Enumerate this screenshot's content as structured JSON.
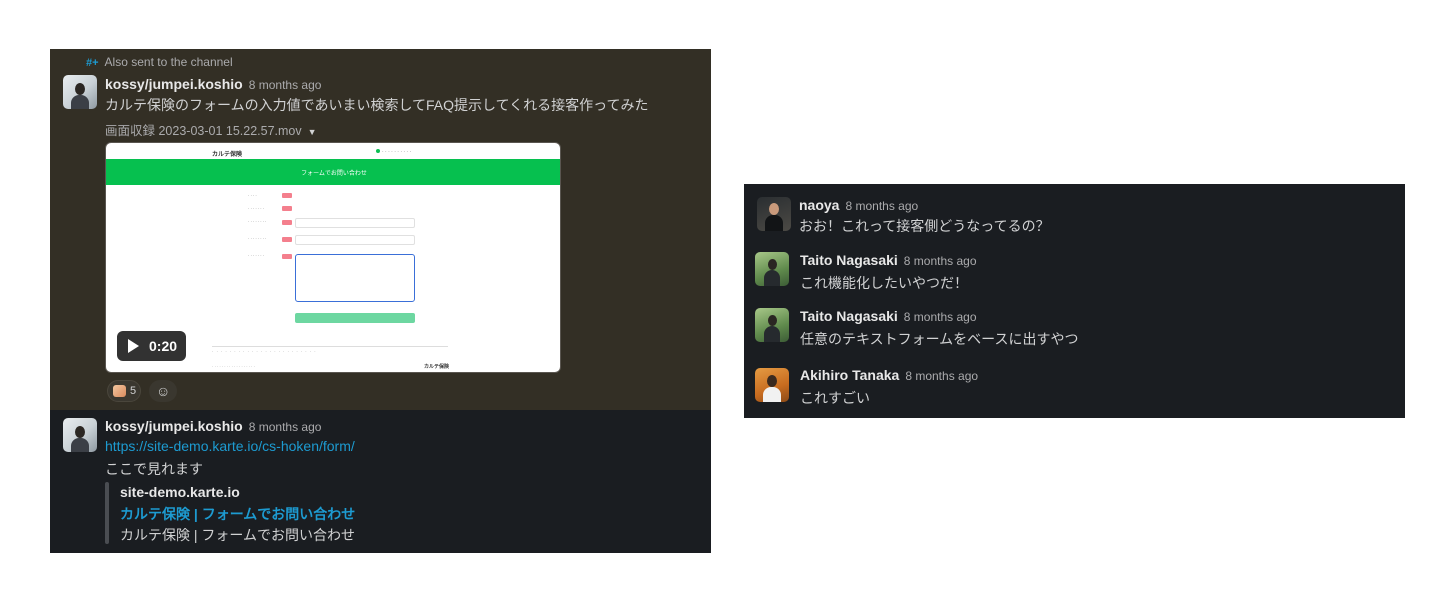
{
  "left_thread": {
    "also_sent": "Also sent to the channel",
    "message1": {
      "sender": "kossy/jumpei.koshio",
      "timestamp": "8 months ago",
      "text": "カルテ保険のフォームの入力値であいまい検索してFAQ提示してくれる接客作ってみた",
      "file": {
        "name": "画面収録 2023-03-01 15.22.57.mov",
        "duration": "0:20"
      },
      "video_preview": {
        "brand": "カルテ保険",
        "banner": "フォームでお問い合わせ"
      },
      "reaction_count": "5"
    },
    "message2": {
      "sender": "kossy/jumpei.koshio",
      "timestamp": "8 months ago",
      "link": "https://site-demo.karte.io/cs-hoken/form/",
      "text": "ここで見れます",
      "unfurl": {
        "site": "site-demo.karte.io",
        "title": "カルテ保険 | フォームでお問い合わせ",
        "description": "カルテ保険 | フォームでお問い合わせ"
      }
    }
  },
  "right_thread": {
    "messages": [
      {
        "sender": "naoya",
        "timestamp": "8 months ago",
        "text": "おお！これって接客側どうなってるの？"
      },
      {
        "sender": "Taito Nagasaki",
        "timestamp": "8 months ago",
        "text": "これ機能化したいやつだ！"
      },
      {
        "sender": "Taito Nagasaki",
        "timestamp": "8 months ago",
        "text": "任意のテキストフォームをベースに出すやつ"
      },
      {
        "sender": "Akihiro Tanaka",
        "timestamp": "8 months ago",
        "text": "これすごい"
      }
    ]
  },
  "colors": {
    "panel_bg": "#1a1d21",
    "highlight_bg": "#332f25",
    "link": "#1d9bd1",
    "banner_green": "#06c04f"
  }
}
